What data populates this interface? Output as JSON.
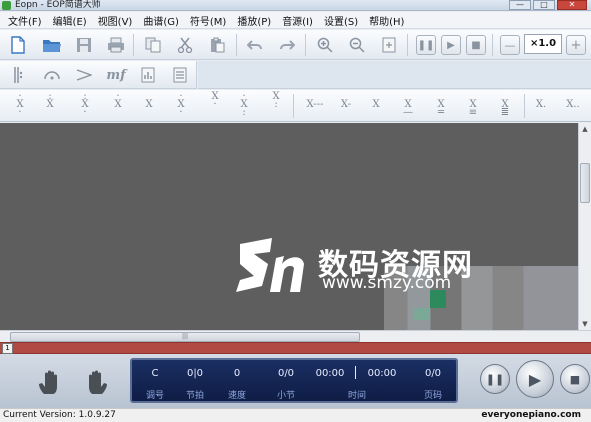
{
  "window": {
    "title": "Eopn - EOP简谱大师",
    "minimize_glyph": "—",
    "maximize_glyph": "□",
    "close_glyph": "✕"
  },
  "menu": [
    "文件(F)",
    "编辑(E)",
    "视图(V)",
    "曲谱(G)",
    "符号(M)",
    "播放(P)",
    "音源(I)",
    "设置(S)",
    "帮助(H)"
  ],
  "toolbar": {
    "zoom_value": "×1.0",
    "zoom_out_label": "—",
    "zoom_in_label": "+"
  },
  "toolbar2": {
    "mf_label": "mf"
  },
  "toolbar3": {
    "notes": [
      "X",
      "X",
      "X",
      "X",
      "X",
      "X",
      "X",
      "X",
      "X",
      "X",
      "X---",
      "X-",
      "X",
      "X",
      "X",
      "X",
      "X",
      "X.",
      "X.."
    ]
  },
  "scroll": {
    "h_thumb_grip": "|||"
  },
  "ruler": {
    "position_marker": "1"
  },
  "lcd": {
    "key": "C",
    "beat": "0|0",
    "tempo": "0",
    "measure": "0/0",
    "time_elapsed": "00:00",
    "time_total": "00:00",
    "page": "0/0",
    "labels": {
      "key": "调号",
      "beat": "节拍",
      "tempo": "速度",
      "measure": "小节",
      "time": "时间",
      "page": "页码"
    }
  },
  "status": {
    "version_text": "Current Version: 1.0.9.27",
    "website": "everyonepiano.com"
  },
  "watermark": {
    "text": "数码资源网",
    "url": "www.smzy.com"
  },
  "colors": {
    "canvas": "#5e5e5e",
    "ruler": "#b14a43",
    "lcd": "#1b2f63"
  }
}
